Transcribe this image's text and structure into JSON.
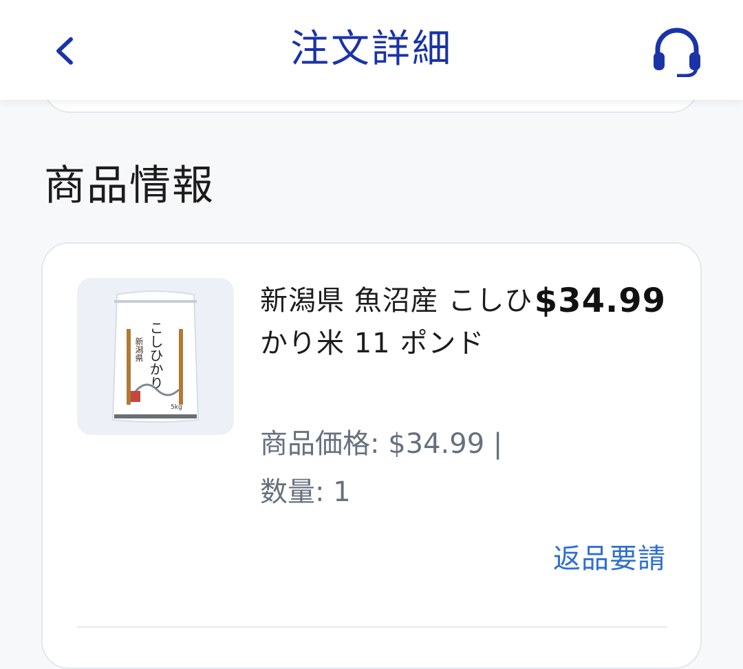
{
  "header": {
    "title": "注文詳細",
    "back_icon": "chevron-left-icon",
    "support_icon": "headset-icon",
    "accent_color": "#1a33a8"
  },
  "section": {
    "title": "商品情報"
  },
  "product": {
    "name": "新潟県 魚沼産 こしひかり米 11 ポンド",
    "price": "$34.99",
    "unit_price_label": "商品価格: $34.99 |",
    "quantity_label": "数量: 1",
    "return_label": "返品要請",
    "image_labels": {
      "main": "こしひかり",
      "origin": "新潟県",
      "weight": "5kg"
    },
    "link_color": "#2f6fd0"
  }
}
